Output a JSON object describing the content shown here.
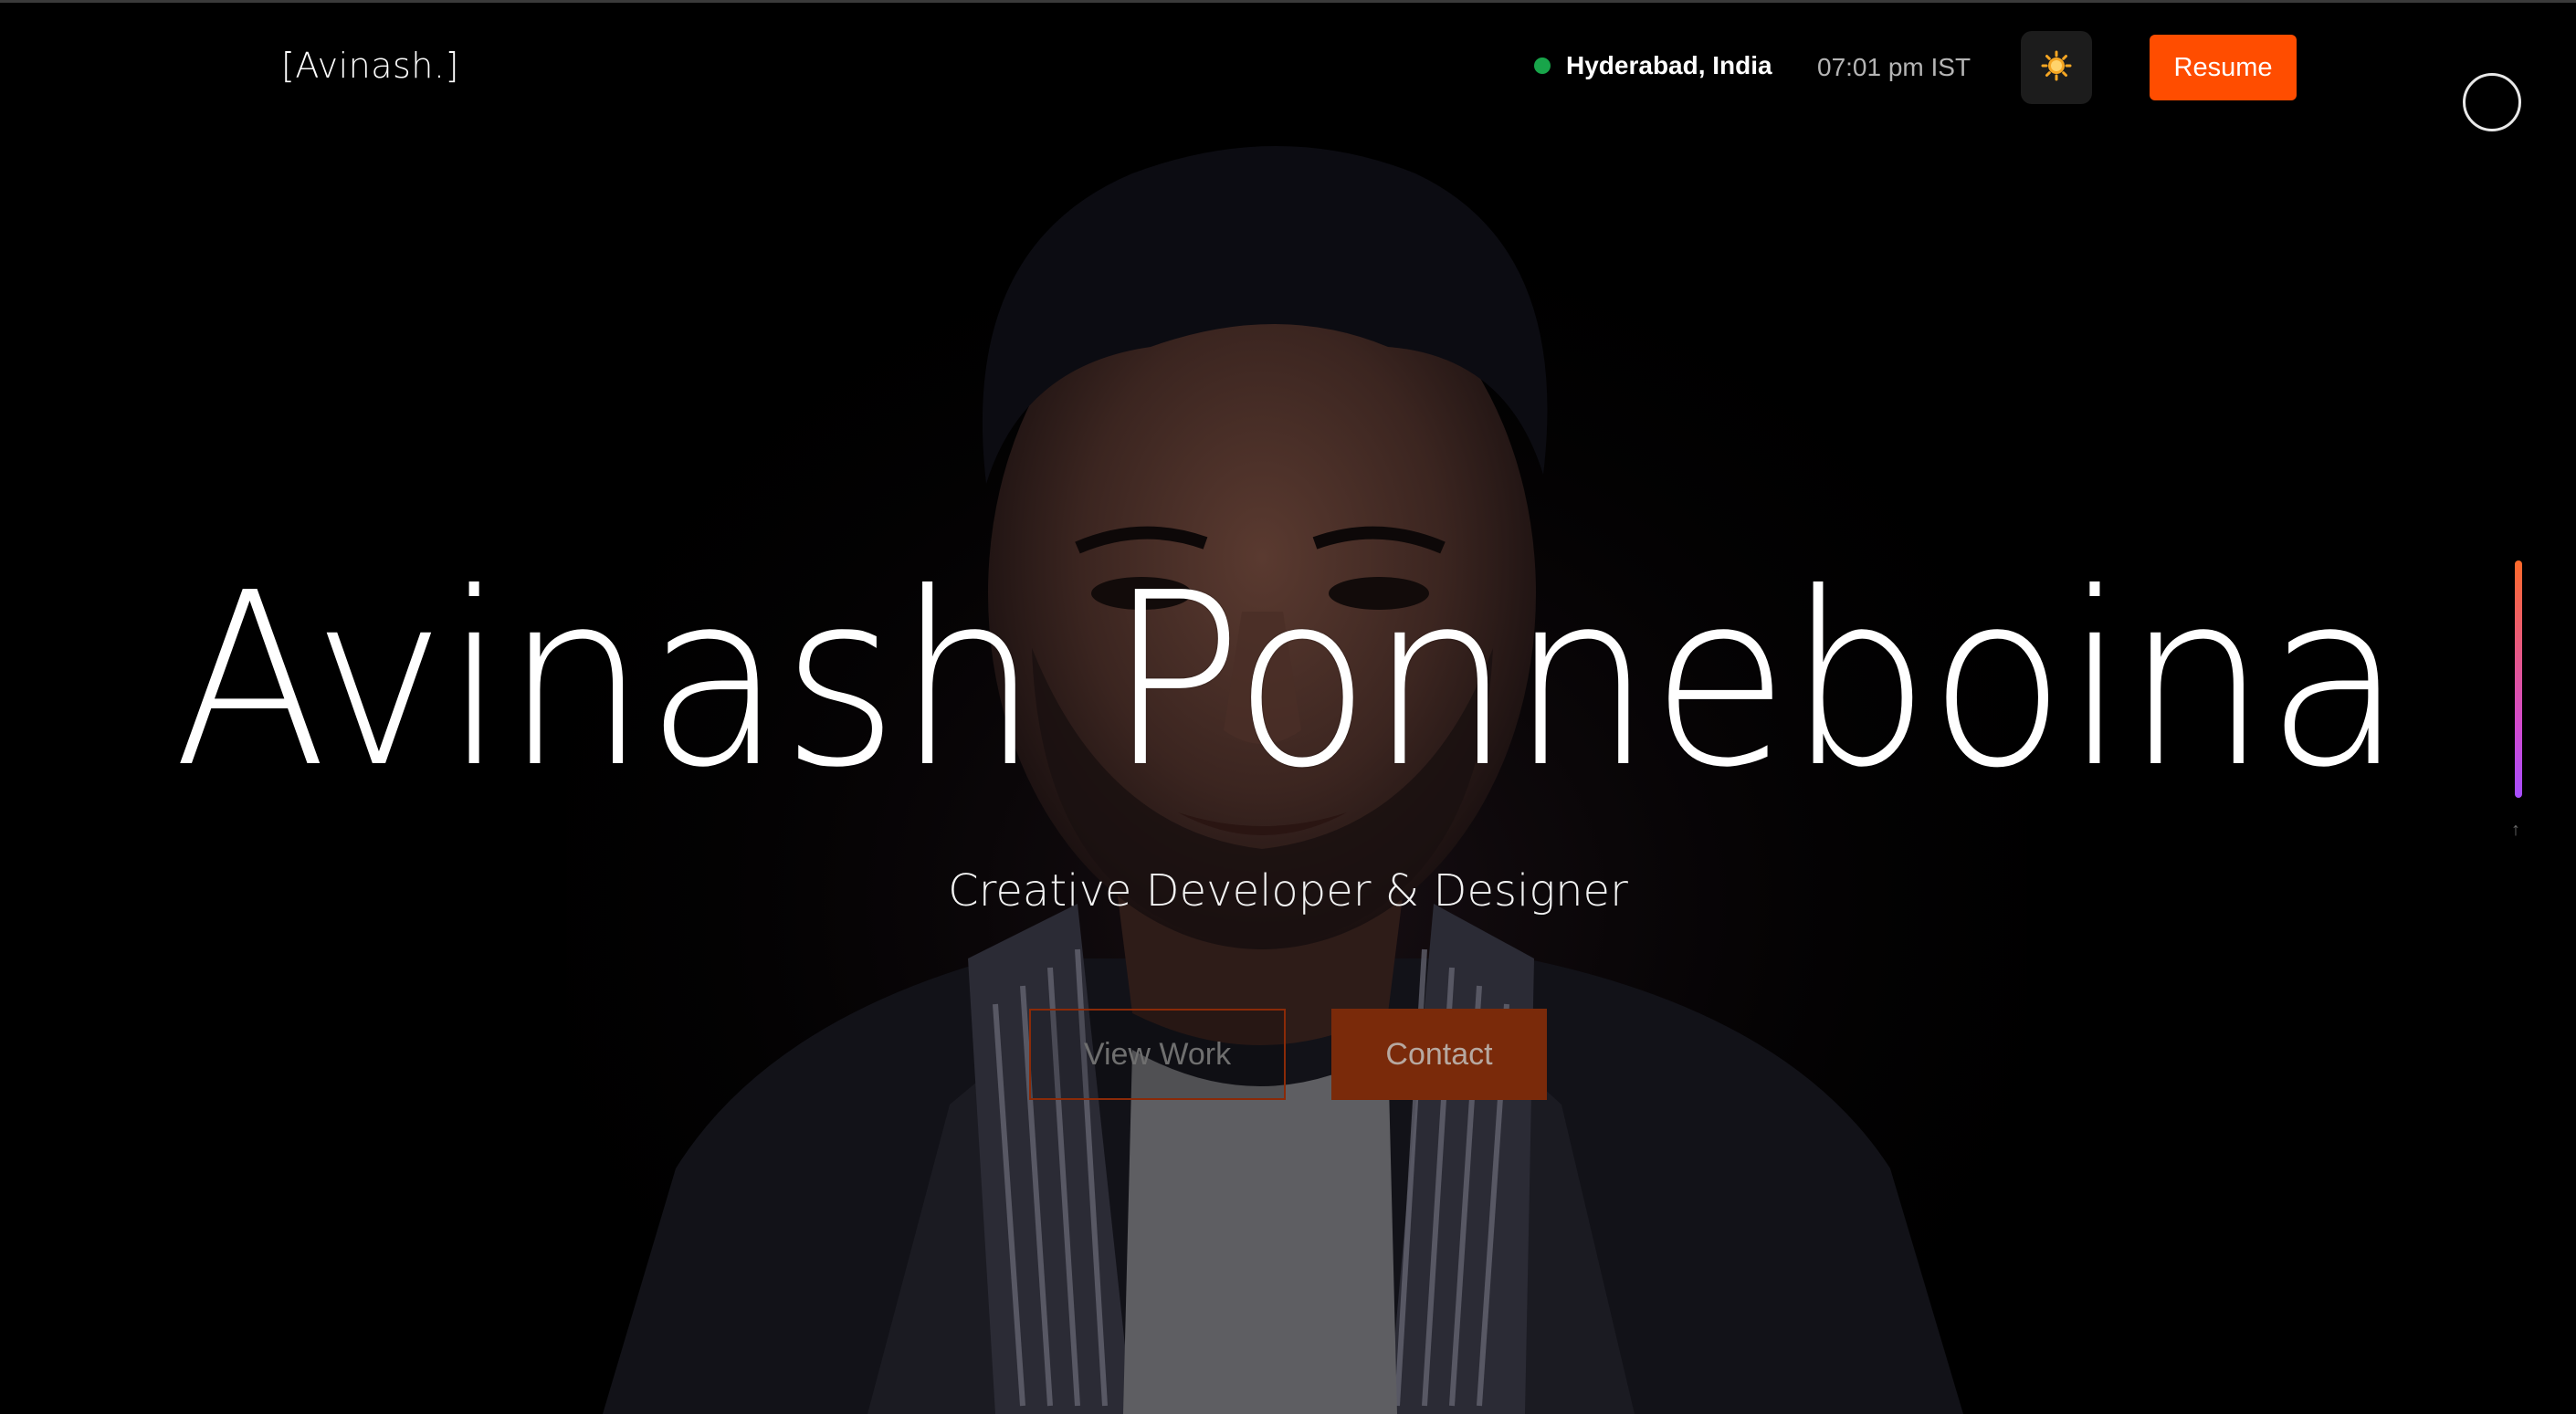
{
  "header": {
    "logo": "[Avinash.]",
    "location": "Hyderabad, India",
    "time": "07:01 pm IST",
    "theme_toggle_icon": "sun-icon",
    "resume_label": "Resume"
  },
  "hero": {
    "name": "Avinash Ponneboina",
    "subtitle": "Creative Developer & Designer",
    "view_work_label": "View Work",
    "contact_label": "Contact"
  },
  "scroll_indicator": {
    "arrow": "↑"
  },
  "colors": {
    "accent": "#ff4d00",
    "status_online": "#18a54a",
    "background": "#000000"
  }
}
